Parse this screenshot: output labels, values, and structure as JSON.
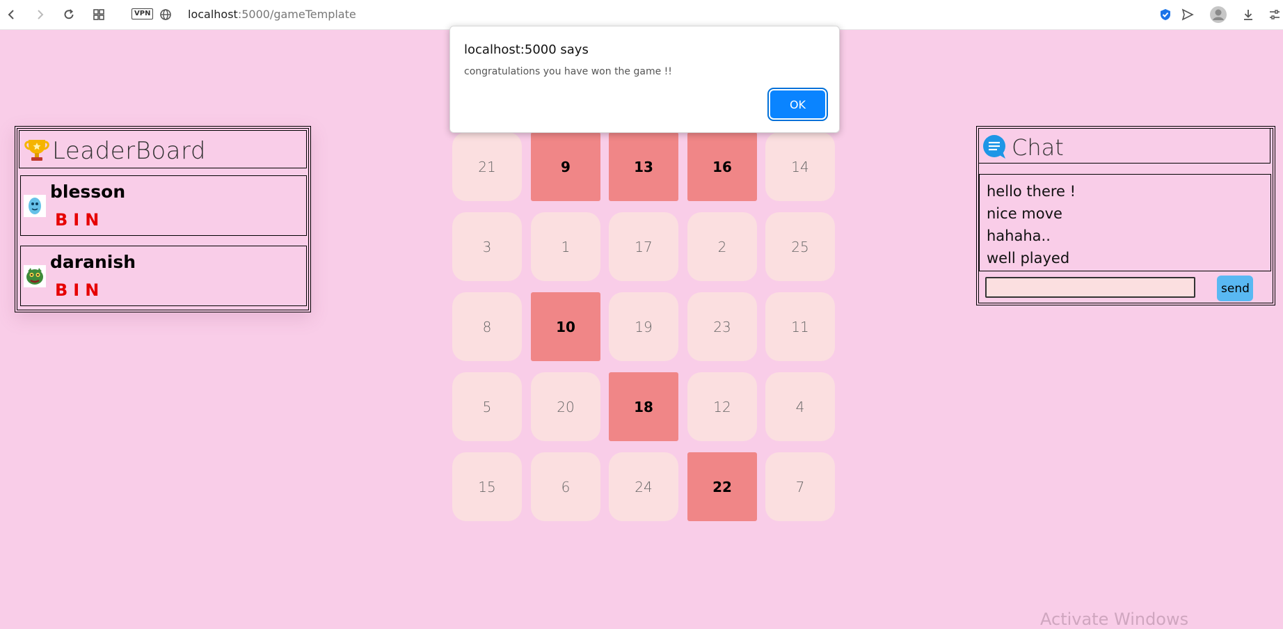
{
  "browser": {
    "vpn_label": "VPN",
    "url_host": "localhost",
    "url_path": ":5000/gameTemplate"
  },
  "leaderboard": {
    "title": "LeaderBoard",
    "players": [
      {
        "name": "blesson",
        "bingo": "BIN"
      },
      {
        "name": "daranish",
        "bingo": "BIN"
      }
    ]
  },
  "board": {
    "cells": [
      {
        "value": "21",
        "marked": false
      },
      {
        "value": "9",
        "marked": true
      },
      {
        "value": "13",
        "marked": true
      },
      {
        "value": "16",
        "marked": true
      },
      {
        "value": "14",
        "marked": false
      },
      {
        "value": "3",
        "marked": false
      },
      {
        "value": "1",
        "marked": false
      },
      {
        "value": "17",
        "marked": false
      },
      {
        "value": "2",
        "marked": false
      },
      {
        "value": "25",
        "marked": false
      },
      {
        "value": "8",
        "marked": false
      },
      {
        "value": "10",
        "marked": true
      },
      {
        "value": "19",
        "marked": false
      },
      {
        "value": "23",
        "marked": false
      },
      {
        "value": "11",
        "marked": false
      },
      {
        "value": "5",
        "marked": false
      },
      {
        "value": "20",
        "marked": false
      },
      {
        "value": "18",
        "marked": true
      },
      {
        "value": "12",
        "marked": false
      },
      {
        "value": "4",
        "marked": false
      },
      {
        "value": "15",
        "marked": false
      },
      {
        "value": "6",
        "marked": false
      },
      {
        "value": "24",
        "marked": false
      },
      {
        "value": "22",
        "marked": true
      },
      {
        "value": "7",
        "marked": false
      }
    ]
  },
  "chat": {
    "title": "Chat",
    "messages": [
      "hello there !",
      "nice move",
      "hahaha..",
      "well played"
    ],
    "input_value": "",
    "send_label": "send"
  },
  "dialog": {
    "title": "localhost:5000 says",
    "message": "congratulations you have won the game !!",
    "ok_label": "OK"
  },
  "colors": {
    "background": "#f9cde8",
    "cell": "#fbdfe0",
    "cell_marked": "#f08687",
    "bingo_text": "#e60000",
    "send_button": "#59b8f2",
    "ok_button": "#0a84ff"
  },
  "watermark": "Activate Windows"
}
